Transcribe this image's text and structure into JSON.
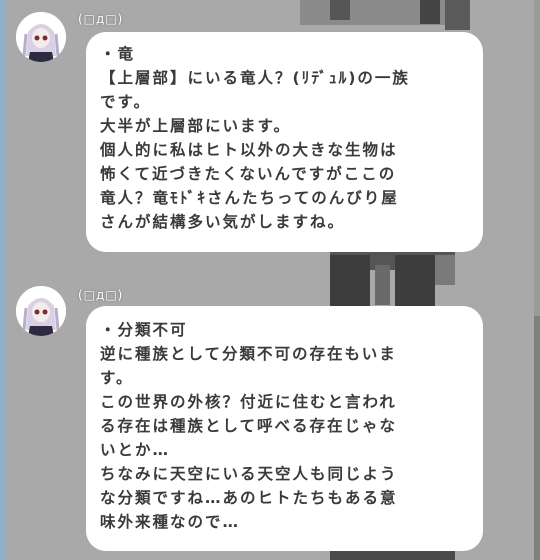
{
  "messages": [
    {
      "sender": "(□д□)",
      "lines": [
        "・竜",
        "【上層部】にいる竜人？(ﾘﾃﾞｭﾙ)の一族",
        "です。",
        "大半が上層部にいます。",
        "個人的に私はヒト以外の大きな生物は",
        "怖くて近づきたくないんですがここの",
        "竜人？竜ﾓﾄﾞｷさんたちってのんびり屋",
        "さんが結構多い気がしますね。"
      ]
    },
    {
      "sender": "(□д□)",
      "lines": [
        "・分類不可",
        "逆に種族として分類不可の存在もいま",
        "す。",
        "この世界の外核？付近に住むと言われ",
        "る存在は種族として呼べる存在じゃな",
        "いとか…",
        "ちなみに天空にいる天空人も同じよう",
        "な分類ですね…あのヒトたちもある意",
        "味外来種なので…"
      ]
    }
  ]
}
